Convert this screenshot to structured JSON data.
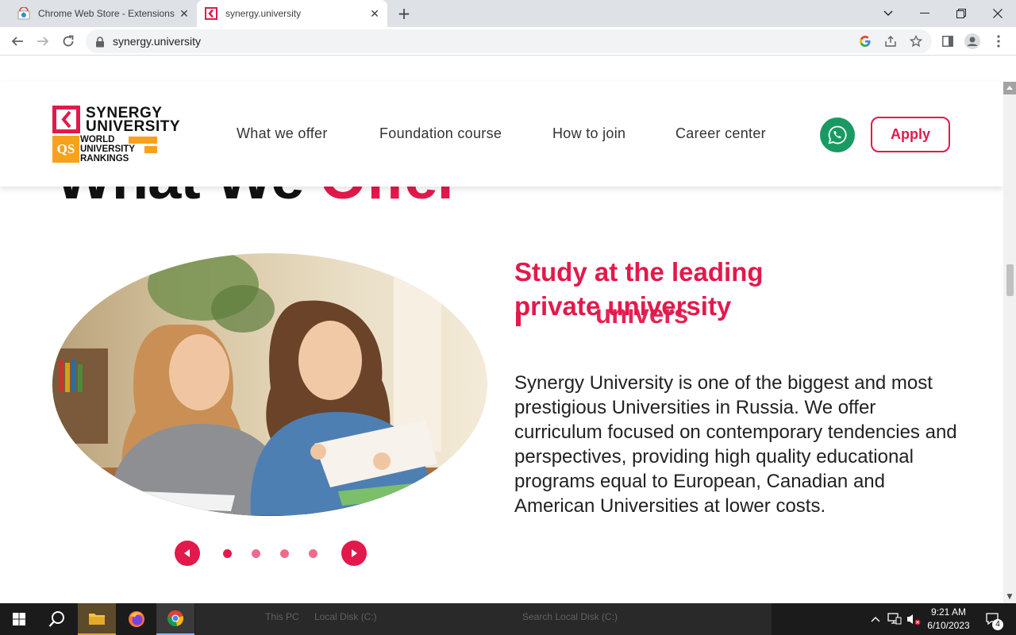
{
  "browser": {
    "tabs": [
      {
        "title": "Chrome Web Store - Extensions",
        "active": false
      },
      {
        "title": "synergy.university",
        "active": true
      }
    ],
    "url": "synergy.university"
  },
  "site": {
    "logo": {
      "line1": "SYNERGY",
      "line2": "UNIVERSITY",
      "qs_badge": "QS",
      "qs_line1": "WORLD",
      "qs_line2": "UNIVERSITY",
      "qs_line3": "RANKINGS"
    },
    "nav": [
      {
        "label": "What we offer"
      },
      {
        "label": "Foundation course"
      },
      {
        "label": "How to join"
      },
      {
        "label": "Career center"
      }
    ],
    "apply_label": "Apply",
    "section_heading": {
      "part1": "What We ",
      "part2": "Offer"
    },
    "subtitle": "Study at the leading private university",
    "subtitle_overlap": "univers",
    "body_text": "Synergy University is one of the biggest and most prestigious Universities in Russia. We offer curriculum focused on contemporary tendencies and perspectives, providing high quality educational programs equal to European, Canadian and American Universities at lower costs.",
    "carousel": {
      "slide_count": 4,
      "active_index": 0
    }
  },
  "taskbar": {
    "explorer_path_1": "This PC",
    "explorer_path_2": "Local Disk (C:)",
    "explorer_search": "Search Local Disk (C:)",
    "time": "9:21 AM",
    "date": "6/10/2023",
    "notification_count": "4"
  },
  "colors": {
    "accent": "#e3194b",
    "whatsapp": "#1a9a63",
    "qs_orange": "#f6a21e"
  }
}
